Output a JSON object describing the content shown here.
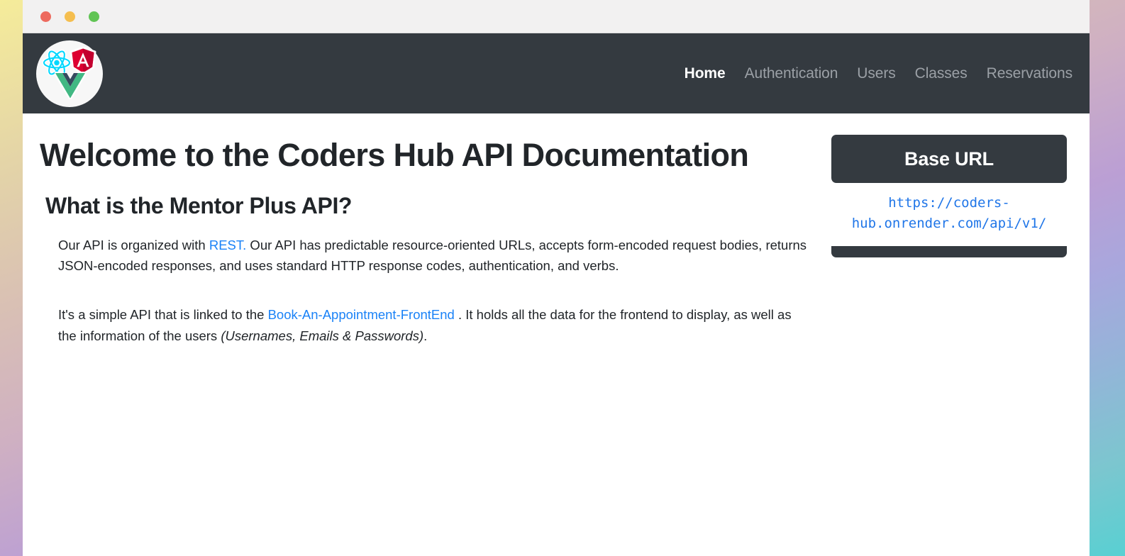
{
  "window": {
    "traffic_lights": [
      {
        "name": "close-button",
        "color": "#ed6a5e"
      },
      {
        "name": "minimize-button",
        "color": "#f5be4f"
      },
      {
        "name": "maximize-button",
        "color": "#61c454"
      }
    ]
  },
  "navbar": {
    "background": "#343a40",
    "logo": {
      "name": "coders-hub-logo",
      "frameworks": [
        "react",
        "angular",
        "vue"
      ],
      "colors": {
        "react": "#00d8ff",
        "angular": "#dd0031",
        "vue_green": "#41b883",
        "vue_dark": "#35495e"
      }
    },
    "links": [
      {
        "label": "Home",
        "active": true
      },
      {
        "label": "Authentication",
        "active": false
      },
      {
        "label": "Users",
        "active": false
      },
      {
        "label": "Classes",
        "active": false
      },
      {
        "label": "Reservations",
        "active": false
      }
    ]
  },
  "main": {
    "page_title": "Welcome to the Coders Hub API Documentation",
    "section_title": "What is the Mentor Plus API?",
    "paragraph1": {
      "before_link": "Our API is organized with ",
      "link_text": "REST.",
      "after_link": " Our API has predictable resource-oriented URLs, accepts form-encoded request bodies, returns JSON-encoded responses, and uses standard HTTP response codes, authentication, and verbs."
    },
    "paragraph2": {
      "before_link": "It's a simple API that is linked to the ",
      "link_text": "Book-An-Appointment-FrontEnd",
      "after_link": " . It holds all the data for the frontend to display, as well as the information of the users ",
      "italic_text": "(Usernames, Emails & Passwords)",
      "tail": "."
    }
  },
  "base_url_card": {
    "header_label": "Base URL",
    "url": "https://coders-hub.onrender.com/api/v1/",
    "header_color": "#343a40",
    "url_color": "#2076e8"
  },
  "theme": {
    "accent_link": "#1a82f7",
    "text": "#212529",
    "nav_muted": "#9ba0a6",
    "titlebar": "#f2f1f1"
  }
}
